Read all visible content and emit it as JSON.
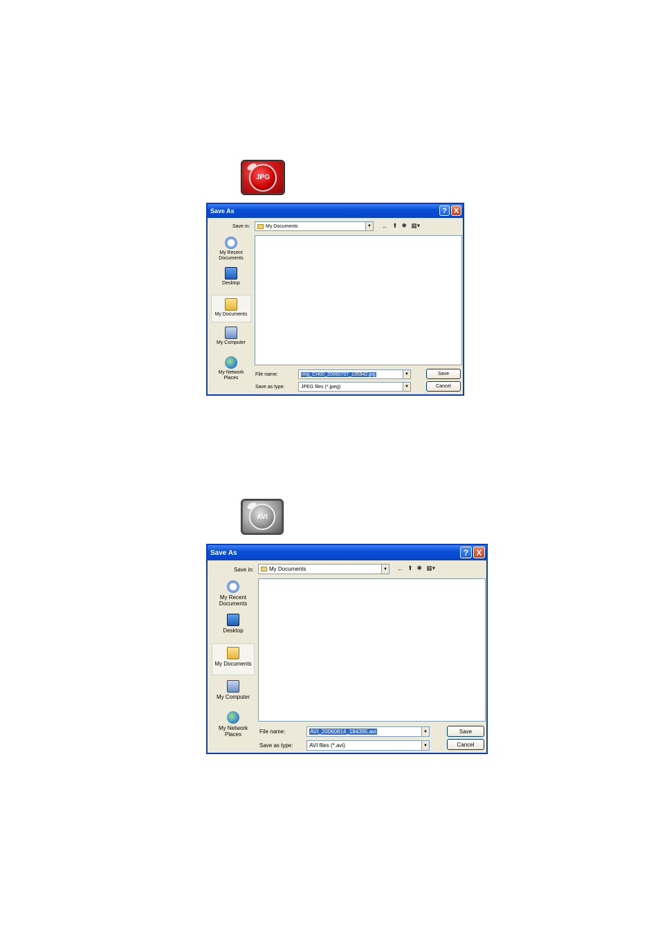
{
  "jpg_button": {
    "label": "JPG"
  },
  "avi_button": {
    "label": "AVI"
  },
  "dialog1": {
    "title": "Save As",
    "help_glyph": "?",
    "close_glyph": "X",
    "save_in_label": "Save in:",
    "save_in_value": "My Documents",
    "places": [
      {
        "label": "My Recent Documents",
        "icon": "recent-documents-icon"
      },
      {
        "label": "Desktop",
        "icon": "desktop-icon"
      },
      {
        "label": "My Documents",
        "icon": "my-documents-icon"
      },
      {
        "label": "My Computer",
        "icon": "my-computer-icon"
      },
      {
        "label": "My Network Places",
        "icon": "network-places-icon"
      }
    ],
    "file_name_label": "File name:",
    "file_name_value": "img_CH00_20060707_135942.jpg",
    "save_as_type_label": "Save as type:",
    "save_as_type_value": "JPEG files (*.jpeg)",
    "save_label": "Save",
    "cancel_label": "Cancel"
  },
  "dialog2": {
    "title": "Save As",
    "help_glyph": "?",
    "close_glyph": "X",
    "save_in_label": "Save in:",
    "save_in_value": "My Documents",
    "places": [
      {
        "label": "My Recent Documents",
        "icon": "recent-documents-icon"
      },
      {
        "label": "Desktop",
        "icon": "desktop-icon"
      },
      {
        "label": "My Documents",
        "icon": "my-documents-icon"
      },
      {
        "label": "My Computer",
        "icon": "my-computer-icon"
      },
      {
        "label": "My Network Places",
        "icon": "network-places-icon"
      }
    ],
    "file_name_label": "File name:",
    "file_name_value": "AVI_20060814_184395.avi",
    "save_as_type_label": "Save as type:",
    "save_as_type_value": "AVI files (*.avi)",
    "save_label": "Save",
    "cancel_label": "Cancel"
  }
}
